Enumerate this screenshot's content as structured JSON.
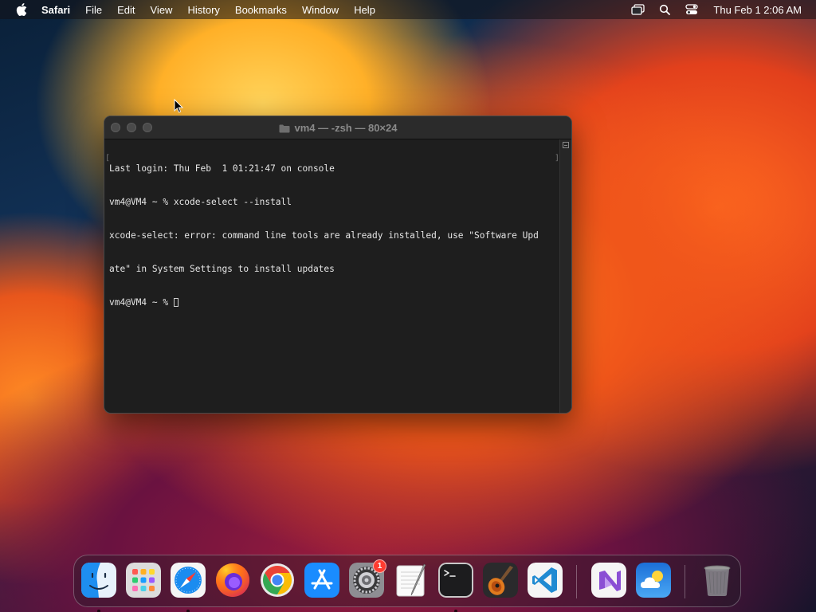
{
  "menubar": {
    "app_name": "Safari",
    "menus": [
      "File",
      "Edit",
      "View",
      "History",
      "Bookmarks",
      "Window",
      "Help"
    ],
    "status_icons": [
      "screen-mirroring-icon",
      "spotlight-search-icon",
      "control-center-icon"
    ],
    "clock": "Thu Feb 1  2:06 AM"
  },
  "terminal": {
    "title": "vm4 — -zsh — 80×24",
    "lines": [
      "Last login: Thu Feb  1 01:21:47 on console",
      "vm4@VM4 ~ % xcode-select --install",
      "xcode-select: error: command line tools are already installed, use \"Software Upd",
      "ate\" in System Settings to install updates"
    ],
    "prompt": "vm4@VM4 ~ % "
  },
  "dock": {
    "items": [
      {
        "name": "Finder",
        "icon": "finder-icon",
        "running": true
      },
      {
        "name": "Launchpad",
        "icon": "launchpad-icon",
        "running": false
      },
      {
        "name": "Safari",
        "icon": "safari-icon",
        "running": true
      },
      {
        "name": "Firefox",
        "icon": "firefox-icon",
        "running": false
      },
      {
        "name": "Google Chrome",
        "icon": "chrome-icon",
        "running": false
      },
      {
        "name": "App Store",
        "icon": "app-store-icon",
        "running": false
      },
      {
        "name": "System Settings",
        "icon": "system-settings-icon",
        "running": false,
        "badge": "1"
      },
      {
        "name": "TextEdit",
        "icon": "textedit-icon",
        "running": false
      },
      {
        "name": "Terminal",
        "icon": "terminal-icon",
        "running": true
      },
      {
        "name": "GarageBand",
        "icon": "garageband-icon",
        "running": false
      },
      {
        "name": "Visual Studio Code",
        "icon": "vscode-icon",
        "running": false
      },
      {
        "name": "Visual Studio",
        "icon": "visual-studio-icon",
        "running": false
      },
      {
        "name": "Weather",
        "icon": "weather-icon",
        "running": false
      },
      {
        "name": "Trash",
        "icon": "trash-icon",
        "running": false
      }
    ],
    "colors": {
      "finder": "#1e8ef0",
      "safari": "#1a8cf0",
      "firefox": "#ff7a18",
      "appstore": "#1a8cff",
      "vscode": "#1f8ad2",
      "visualstudio": "#8a4fd4",
      "weather": "#2a86e8",
      "badge": "#ff3b30"
    }
  }
}
